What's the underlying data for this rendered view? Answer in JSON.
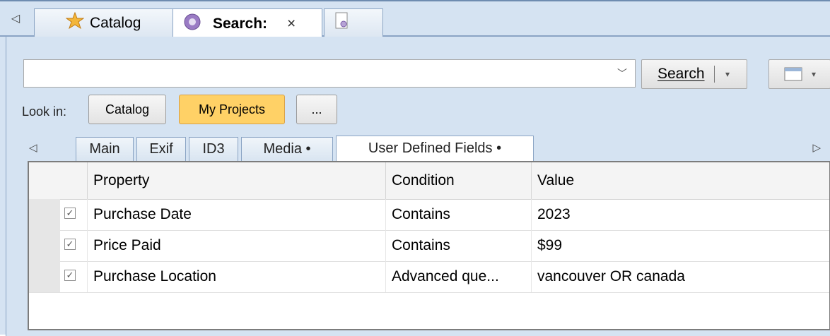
{
  "doc_tabs": [
    {
      "label": "Catalog",
      "icon": "catalog-star-icon"
    },
    {
      "label": "Search:",
      "icon": "search-globe-icon",
      "close": "×"
    },
    {
      "label": "",
      "icon": "document-lock-icon"
    }
  ],
  "search": {
    "query_value": "",
    "button_label": "Search",
    "dropdown_glyph": "▾"
  },
  "look_in": {
    "label": "Look in:",
    "options": [
      "Catalog",
      "My Projects",
      "..."
    ],
    "selected": "My Projects"
  },
  "sub_tabs": [
    {
      "label": "Main"
    },
    {
      "label": "Exif"
    },
    {
      "label": "ID3"
    },
    {
      "label": "Media •"
    },
    {
      "label": "User Defined Fields •"
    }
  ],
  "grid": {
    "columns": [
      "Property",
      "Condition",
      "Value"
    ],
    "rows": [
      {
        "checked": true,
        "property": "Purchase Date",
        "condition": "Contains",
        "value": "2023"
      },
      {
        "checked": true,
        "property": "Price Paid",
        "condition": "Contains",
        "value": "$99"
      },
      {
        "checked": true,
        "property": "Purchase Location",
        "condition": "Advanced que...",
        "value": "vancouver OR canada"
      }
    ]
  },
  "colors": {
    "selected_pill": "#ffd166",
    "chrome": "#d5e3f2"
  }
}
